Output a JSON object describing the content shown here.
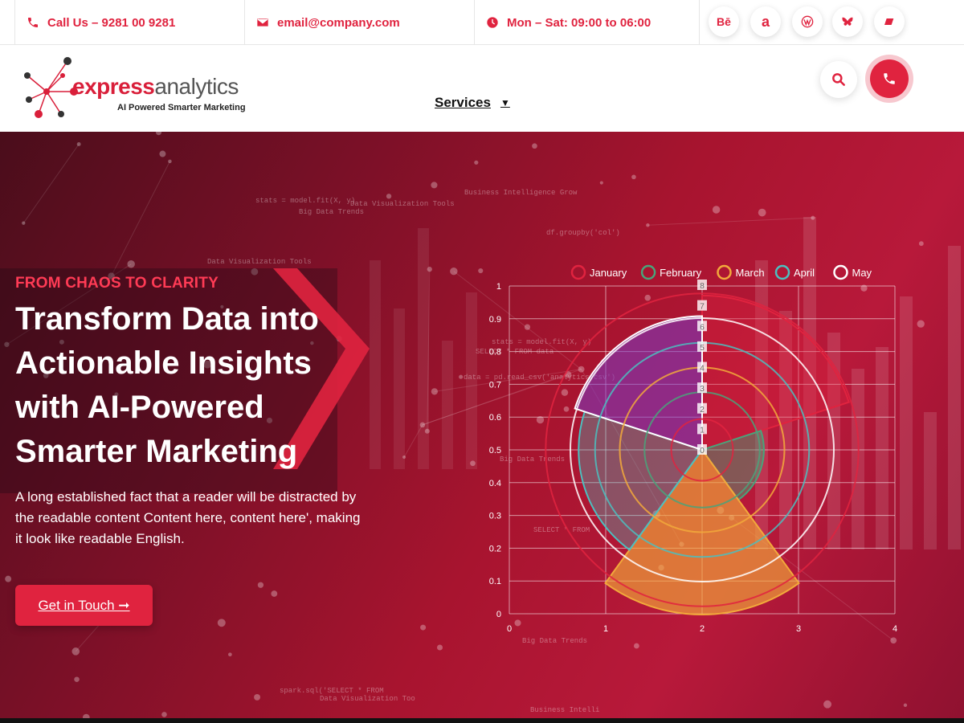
{
  "topbar": {
    "phone": "Call Us – 9281 00 9281",
    "email": "email@company.com",
    "hours": "Mon – Sat: 09:00 to 06:00",
    "social": [
      "Bē",
      "a",
      "W",
      "bluesky",
      "eraser"
    ]
  },
  "header": {
    "logo_word_a": "express",
    "logo_word_b": "analytics",
    "logo_tagline": "AI Powered Smarter Marketing",
    "nav_services": "Services"
  },
  "hero": {
    "eyebrow": "FROM CHAOS TO CLARITY",
    "headline": "Transform Data into Actionable Insights with AI-Powered Smarter Marketing",
    "lead": "A long established fact that a reader will be distracted by the readable content Content here, content here', making it look like readable English.",
    "cta": "Get in Touch ➞",
    "bg_texts": [
      "stats = model.fit(X, y)",
      "Big Data Trends",
      "Data Visualization Tools",
      "Business Intelligence Grow",
      "df.groupby('col')",
      "Data Visualization Tools",
      "stats = model.fit(X, y)",
      "SELECT * FROM data",
      "data = pd.read_csv('analytics.csv')",
      "Big Data Trends",
      "SELECT * FROM",
      "Big Data Trends",
      "spark.sql('SELECT * FROM",
      "Data Visualization Too",
      "Business Intelli"
    ]
  },
  "colors": {
    "accent": "#e0233f",
    "hero_dark": "#4a0d1b",
    "hero_red": "#b8193a"
  },
  "chart_data": {
    "type": "polar-area",
    "legend": [
      "January",
      "February",
      "March",
      "April",
      "May"
    ],
    "legend_colors": [
      "#e0233f",
      "#4aa37a",
      "#f2a93b",
      "#4bc0c0",
      "#ffffff"
    ],
    "y_ticks": [
      "0",
      "0.1",
      "0.2",
      "0.3",
      "0.4",
      "0.5",
      "0.6",
      "0.7",
      "0.8",
      "0.9",
      "1"
    ],
    "x_ticks": [
      "0",
      "1",
      "2",
      "3",
      "4"
    ],
    "ylim": [
      0,
      1
    ],
    "xlim": [
      0,
      4
    ],
    "radial_ticks": [
      "8",
      "7",
      "6",
      "5",
      "4",
      "3",
      "2",
      "1",
      "0"
    ],
    "series_values": [
      7.5,
      3,
      8,
      6,
      6.5
    ]
  }
}
